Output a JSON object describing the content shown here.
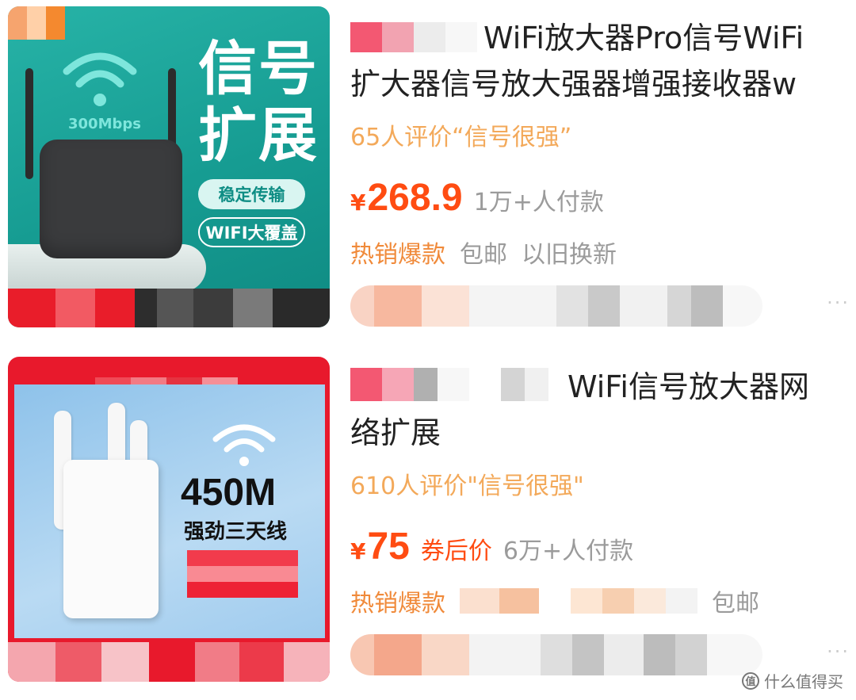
{
  "products": [
    {
      "image": {
        "wifi_speed": "300Mbps",
        "headline_line1": "信号",
        "headline_line2": "扩展",
        "badge_solid": "稳定传输",
        "badge_outline": "WIFI大覆盖"
      },
      "title_line1": "WiFi放大器Pro信号WiFi",
      "title_line2": "扩大器信号放大强器增强接收器w",
      "rating": "65人评价“信号很强”",
      "currency": "¥",
      "price": "268.9",
      "price_note": "",
      "paid_count": "1万+人付款",
      "tags": [
        "热销爆款",
        "包邮",
        "以旧换新"
      ],
      "more": "···"
    },
    {
      "image": {
        "speed": "450M",
        "slogan": "强劲三天线"
      },
      "title_line1": "WiFi信号放大器网",
      "title_line2": "络扩展",
      "rating": "610人评价\"信号很强\"",
      "currency": "¥",
      "price": "75",
      "price_note": "券后价",
      "paid_count": "6万+人付款",
      "tags": [
        "热销爆款",
        "包邮"
      ],
      "more": "···"
    }
  ],
  "watermark": {
    "symbol": "值",
    "text": "什么值得买"
  },
  "colors": {
    "price": "#ff4c12",
    "rating": "#f3a95a",
    "hot_tag": "#f08a3a",
    "muted": "#9b9b9b",
    "card1_bg": "#169c92",
    "card2_bg": "#e8192c"
  }
}
